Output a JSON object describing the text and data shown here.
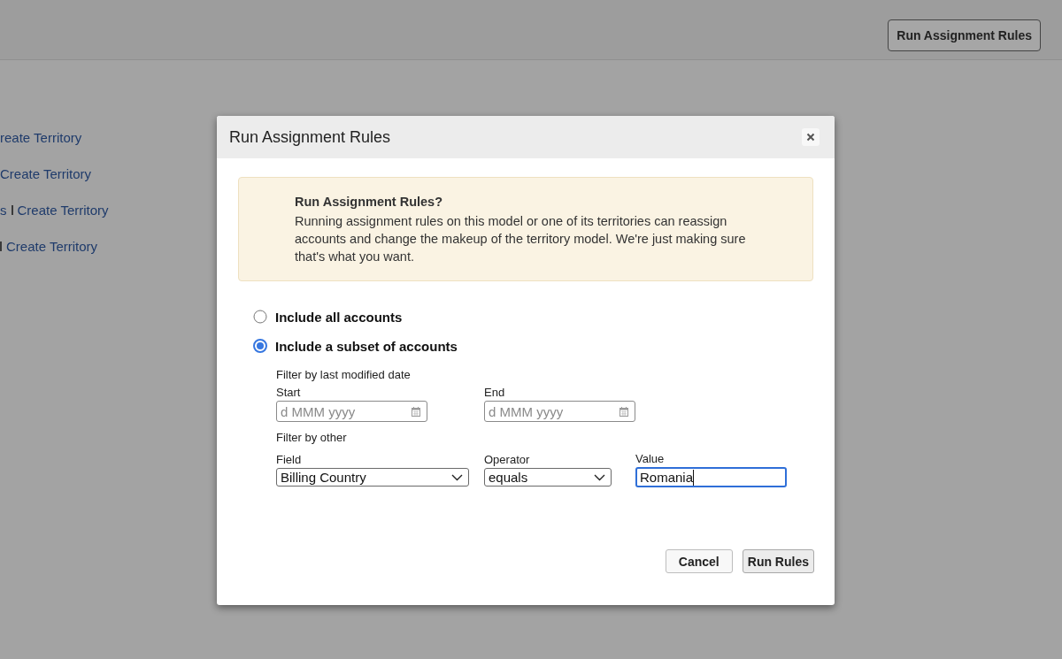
{
  "header": {
    "button": "Run Assignment Rules"
  },
  "background_links": [
    {
      "link": "reate Territory",
      "separator": false
    },
    {
      "link": "Create Territory",
      "separator": false
    },
    {
      "lead": "s",
      "link": "Create Territory",
      "separator": true
    },
    {
      "link": "Create Territory",
      "separator": true
    }
  ],
  "dialog": {
    "title": "Run Assignment Rules",
    "alert": {
      "heading": "Run Assignment Rules?",
      "message": "Running assignment rules on this model or one of its territories can reassign accounts and change the makeup of the territory model. We're just making sure that's what you want."
    },
    "scope_options": [
      {
        "label": "Include all accounts",
        "selected": false
      },
      {
        "label": "Include a subset of accounts",
        "selected": true
      }
    ],
    "date_filter": {
      "heading": "Filter by last modified date",
      "start": {
        "label": "Start",
        "placeholder": "d MMM yyyy"
      },
      "end": {
        "label": "End",
        "placeholder": "d MMM yyyy"
      }
    },
    "other_filter": {
      "heading": "Filter by other",
      "field": {
        "label": "Field",
        "value": "Billing Country"
      },
      "operator": {
        "label": "Operator",
        "value": "equals"
      },
      "value": {
        "label": "Value",
        "value": "Romania",
        "focused": true
      }
    },
    "buttons": [
      {
        "label": "Cancel",
        "kind": "secondary"
      },
      {
        "label": "Run Rules",
        "kind": "primary"
      }
    ]
  }
}
